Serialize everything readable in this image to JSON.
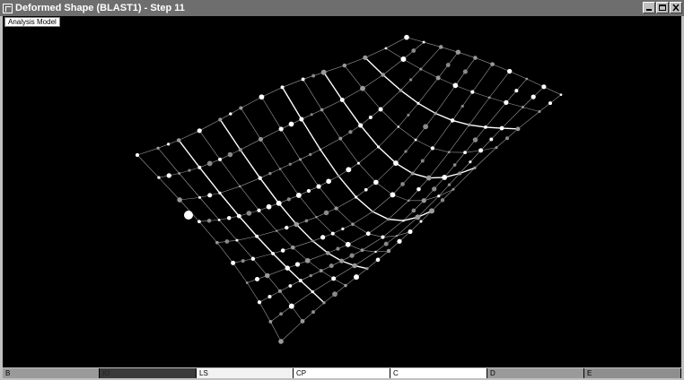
{
  "window": {
    "title": "Deformed Shape (BLAST1) - Step 11",
    "controls": [
      "minimize-icon",
      "maximize-icon",
      "close-icon"
    ]
  },
  "viewport": {
    "label": "Analysis Model",
    "background": "#000000",
    "wire_color": "#cfcfcf",
    "node_color": "#ffffff"
  },
  "legend": {
    "segments": [
      {
        "label": "B",
        "color": "#9a9a9a",
        "text_color": "#000000"
      },
      {
        "label": "IO",
        "color": "#3a3a3a",
        "text_color": "#222222"
      },
      {
        "label": "LS",
        "color": "#f2f2f2",
        "text_color": "#000000"
      },
      {
        "label": "CP",
        "color": "#ffffff",
        "text_color": "#000000"
      },
      {
        "label": "C",
        "color": "#ffffff",
        "text_color": "#000000"
      },
      {
        "label": "D",
        "color": "#9a9a9a",
        "text_color": "#000000"
      },
      {
        "label": "E",
        "color": "#8e8e8e",
        "text_color": "#000000"
      }
    ]
  }
}
